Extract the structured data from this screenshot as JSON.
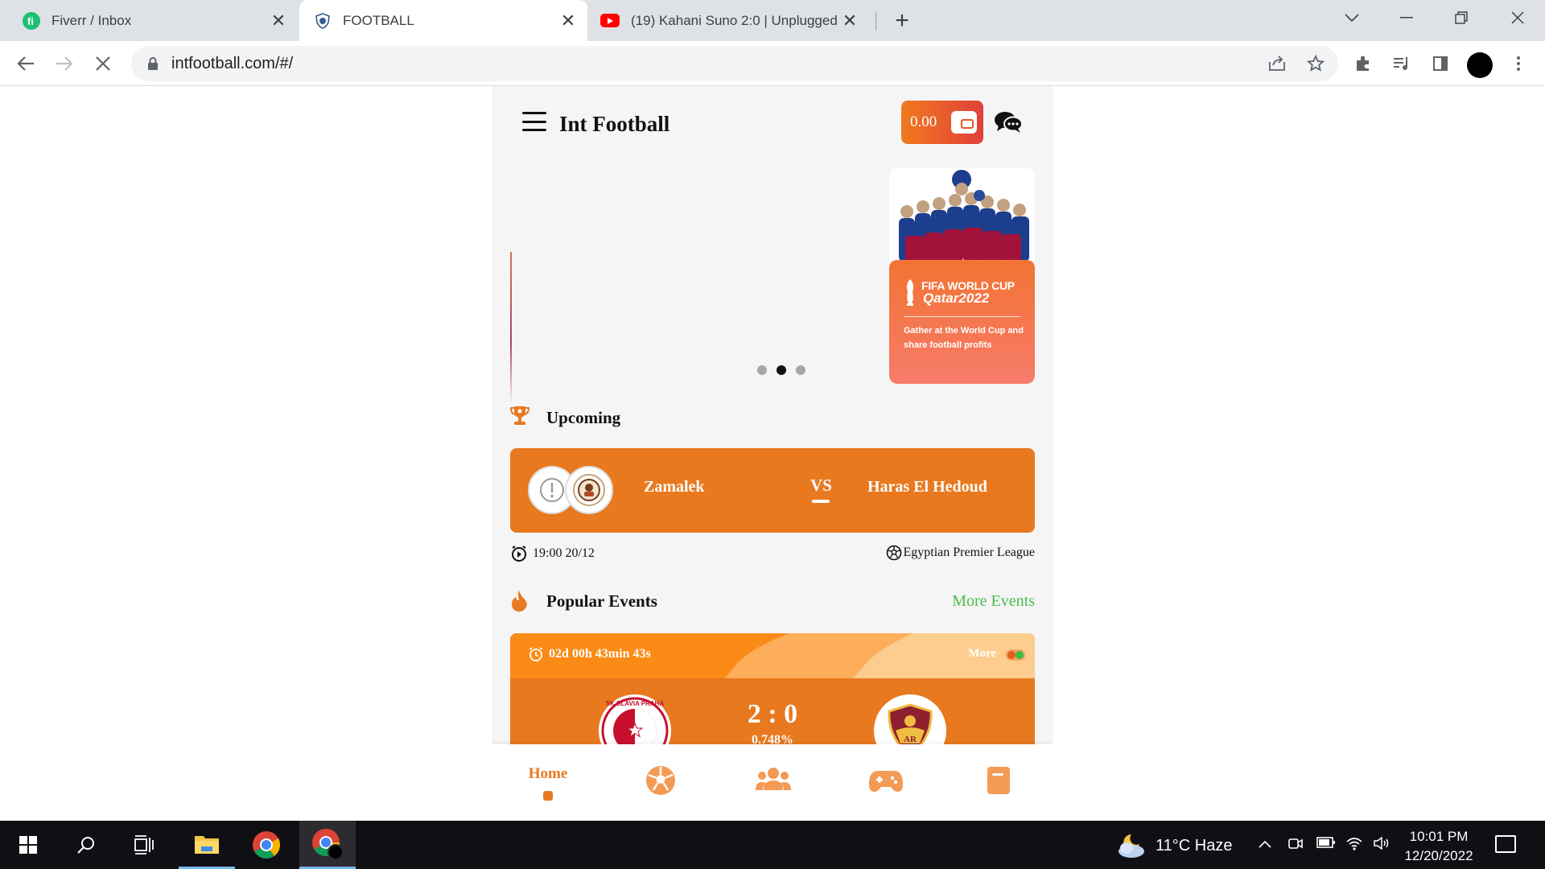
{
  "browser": {
    "tabs": [
      {
        "title": "Fiverr / Inbox",
        "active": false
      },
      {
        "title": "FOOTBALL",
        "active": true
      },
      {
        "title": "(19) Kahani Suno 2:0 | Unplugged",
        "active": false
      }
    ],
    "url": "intfootball.com/#/"
  },
  "app": {
    "brand": "Int Football",
    "wallet_amount": "0.00",
    "promo": {
      "line1": "FIFA WORLD CUP",
      "line2": "Qatar2022",
      "desc": "Gather at the World Cup and share football profits"
    },
    "carousel_active_dot": 2,
    "upcoming": {
      "title": "Upcoming",
      "home": "Zamalek",
      "vs": "VS",
      "away": "Haras El Hedoud",
      "time": "19:00 20/12",
      "league": "Egyptian Premier League"
    },
    "popular": {
      "title": "Popular Events",
      "more_link": "More Events",
      "countdown": "02d 00h 43min 43s",
      "more": "More",
      "score": "2 : 0",
      "pct": "0.748%"
    },
    "bottom_nav": {
      "home": "Home",
      "items": [
        "soccer-ball-icon",
        "users-icon",
        "gamepad-icon",
        "document-icon"
      ]
    }
  },
  "taskbar": {
    "weather": "11°C  Haze",
    "time": "10:01 PM",
    "date": "12/20/2022"
  },
  "colors": {
    "accent": "#e8791f",
    "link_green": "#4cbd4c",
    "taskbar": "#0f0f14"
  }
}
